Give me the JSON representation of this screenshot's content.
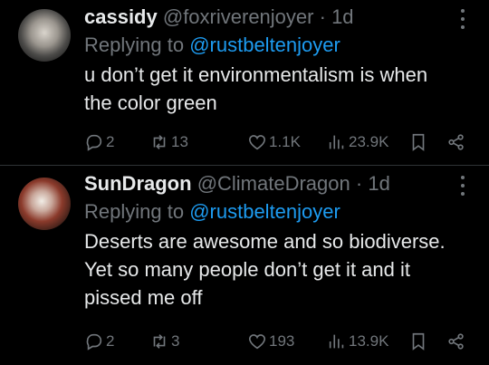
{
  "tweets": [
    {
      "name": "cassidy",
      "handle": "@foxriverenjoyer",
      "dot": "·",
      "time": "1d",
      "replying_prefix": "Replying to",
      "replying_to": "@rustbeltenjoyer",
      "text_lines": [
        "u don’t get it environmentalism is when",
        "the color green"
      ],
      "replies": "2",
      "retweets": "13",
      "likes": "1.1K",
      "views": "23.9K"
    },
    {
      "name": "SunDragon",
      "handle": "@ClimateDragon",
      "dot": "·",
      "time": "1d",
      "replying_prefix": "Replying to",
      "replying_to": "@rustbeltenjoyer",
      "text_lines": [
        "Deserts are awesome and so biodiverse.",
        "Yet so many people don’t get it and it",
        "pissed me off"
      ],
      "replies": "2",
      "retweets": "3",
      "likes": "193",
      "views": "13.9K"
    }
  ],
  "colors": {
    "background": "#000000",
    "text": "#e7e9ea",
    "muted": "#71767b",
    "link": "#1d9bf0",
    "divider": "#2f3336"
  },
  "icons": [
    "reply-icon",
    "retweet-icon",
    "like-icon",
    "views-icon",
    "bookmark-icon",
    "share-icon",
    "more-icon"
  ]
}
